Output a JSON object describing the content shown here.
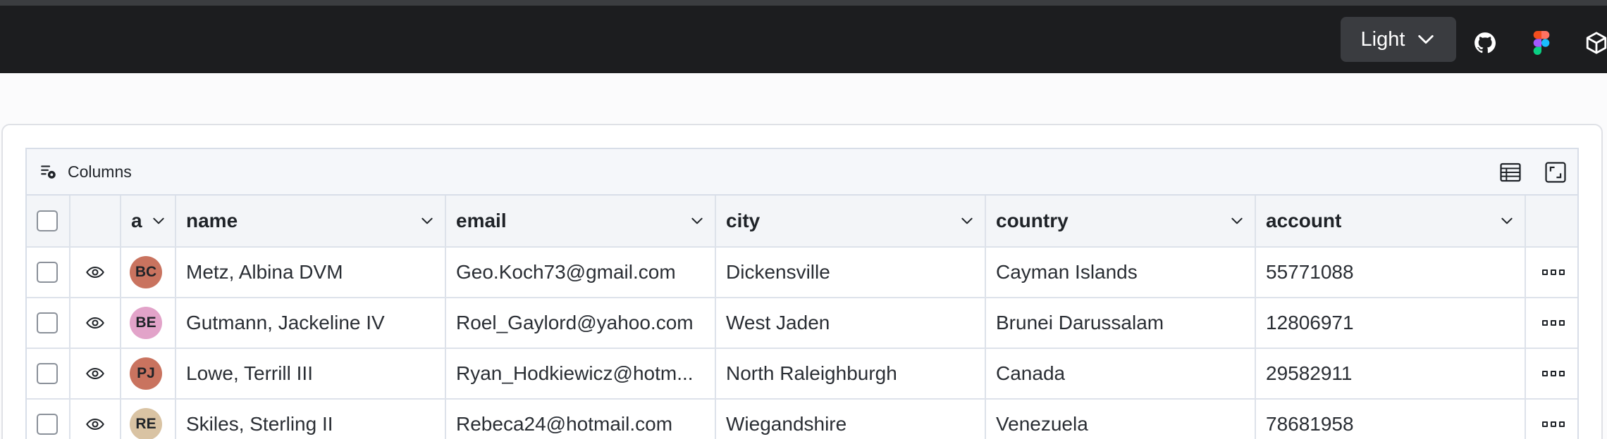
{
  "header": {
    "theme_label": "Light"
  },
  "toolbar": {
    "columns_label": "Columns"
  },
  "table": {
    "headers": {
      "avatar": "a",
      "name": "name",
      "email": "email",
      "city": "city",
      "country": "country",
      "account": "account"
    },
    "rows": [
      {
        "initials": "BC",
        "avatar_color": "#c9735f",
        "name": "Metz, Albina DVM",
        "email": "Geo.Koch73@gmail.com",
        "city": "Dickensville",
        "country": "Cayman Islands",
        "account": "55771088"
      },
      {
        "initials": "BE",
        "avatar_color": "#e2a3c9",
        "name": "Gutmann, Jackeline IV",
        "email": "Roel_Gaylord@yahoo.com",
        "city": "West Jaden",
        "country": "Brunei Darussalam",
        "account": "12806971"
      },
      {
        "initials": "PJ",
        "avatar_color": "#c9735f",
        "name": "Lowe, Terrill III",
        "email": "Ryan_Hodkiewicz@hotm...",
        "city": "North Raleighburgh",
        "country": "Canada",
        "account": "29582911"
      },
      {
        "initials": "RE",
        "avatar_color": "#d9c3a3",
        "name": "Skiles, Sterling II",
        "email": "Rebeca24@hotmail.com",
        "city": "Wiegandshire",
        "country": "Venezuela",
        "account": "78681958"
      }
    ]
  }
}
